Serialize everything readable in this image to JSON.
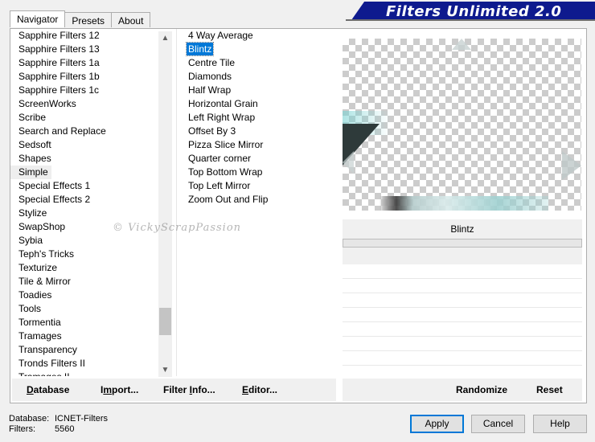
{
  "tabs": [
    "Navigator",
    "Presets",
    "About"
  ],
  "banner_title": "Filters Unlimited 2.0",
  "categories": [
    "Sapphire Filters 12",
    "Sapphire Filters 13",
    "Sapphire Filters 1a",
    "Sapphire Filters 1b",
    "Sapphire Filters 1c",
    "ScreenWorks",
    "Scribe",
    "Search and Replace",
    "Sedsoft",
    "Shapes",
    "Simple",
    "Special Effects 1",
    "Special Effects 2",
    "Stylize",
    "SwapShop",
    "Sybia",
    "Teph's Tricks",
    "Texturize",
    "Tile & Mirror",
    "Toadies",
    "Tools",
    "Tormentia",
    "Tramages",
    "Transparency",
    "Tronds Filters II",
    "Tramages II"
  ],
  "selected_category": "Simple",
  "filters": [
    "4 Way Average",
    "Blintz",
    "Centre Tile",
    "Diamonds",
    "Half Wrap",
    "Horizontal Grain",
    "Left Right Wrap",
    "Offset By 3",
    "Pizza Slice Mirror",
    "Quarter corner",
    "Top Bottom Wrap",
    "Top Left Mirror",
    "Zoom Out and Flip"
  ],
  "selected_filter": "Blintz",
  "watermark": "© VickyScrapPassion",
  "left_buttons": {
    "database": {
      "u": "D",
      "rest": "atabase"
    },
    "import": {
      "pre": "I",
      "u": "m",
      "rest": "port..."
    },
    "filter_info": {
      "pre": "Filter ",
      "u": "I",
      "rest": "nfo..."
    },
    "editor": {
      "u": "E",
      "rest": "ditor..."
    }
  },
  "right_buttons": {
    "randomize": "Randomize",
    "reset": "Reset"
  },
  "status": {
    "database_label": "Database:",
    "database_value": "ICNET-Filters",
    "filters_label": "Filters:",
    "filters_value": "5560"
  },
  "dialog_buttons": {
    "apply": "Apply",
    "cancel": "Cancel",
    "help": "Help"
  }
}
